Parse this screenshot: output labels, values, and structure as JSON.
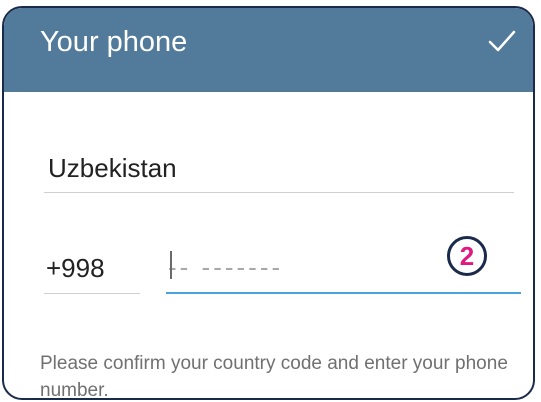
{
  "header": {
    "title": "Your phone",
    "confirm_icon": "checkmark-icon",
    "background_color": "#527a9b"
  },
  "form": {
    "country": "Uzbekistan",
    "country_code": "+998",
    "phone_placeholder": "-- -------",
    "phone_value": ""
  },
  "annotation": {
    "step_number": "2",
    "color": "#e0187f"
  },
  "hint_text": "Please confirm your country code and enter your phone number.",
  "colors": {
    "accent_underline": "#4aa3df"
  }
}
